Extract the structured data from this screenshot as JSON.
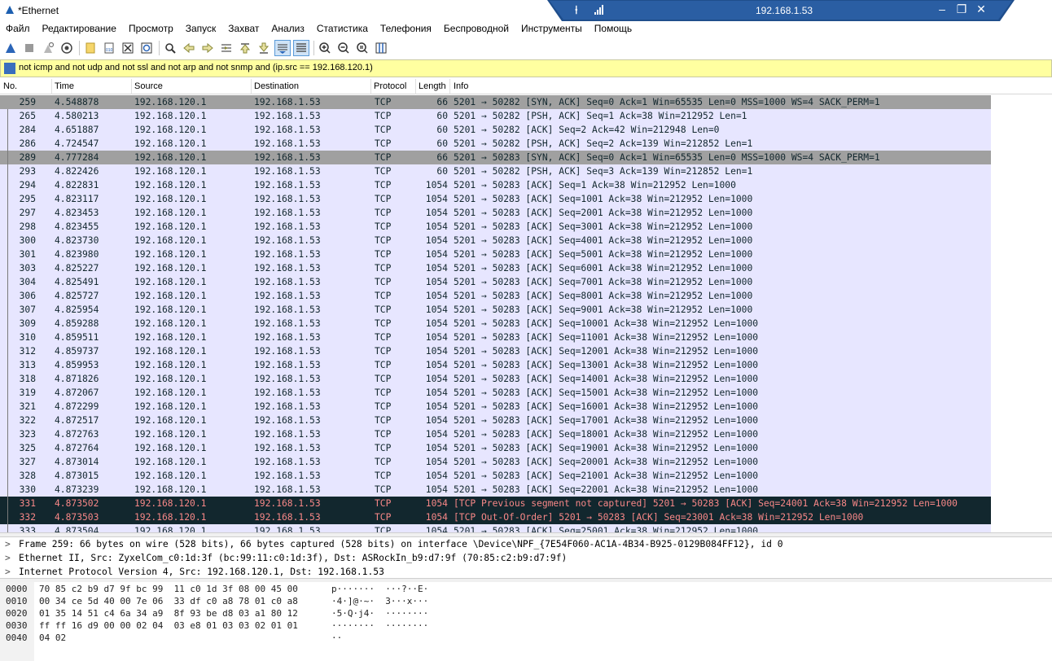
{
  "window": {
    "title": "*Ethernet"
  },
  "remote": {
    "ip": "192.168.1.53",
    "minimize": "‒",
    "restore": "❐",
    "close": "✕",
    "pin": "⍿"
  },
  "menu": [
    "Файл",
    "Редактирование",
    "Просмотр",
    "Запуск",
    "Захват",
    "Анализ",
    "Статистика",
    "Телефония",
    "Беспроводной",
    "Инструменты",
    "Помощь"
  ],
  "filter": {
    "value": "not icmp and not udp and not ssl and not arp and not snmp and (ip.src == 192.168.120.1)"
  },
  "columns": {
    "no": "No.",
    "time": "Time",
    "source": "Source",
    "destination": "Destination",
    "protocol": "Protocol",
    "length": "Length",
    "info": "Info"
  },
  "packets": [
    {
      "no": "259",
      "time": "4.548878",
      "src": "192.168.120.1",
      "dst": "192.168.1.53",
      "proto": "TCP",
      "len": "66",
      "info": "5201 → 50282 [SYN, ACK] Seq=0 Ack=1 Win=65535 Len=0 MSS=1000 WS=4 SACK_PERM=1",
      "style": "sel"
    },
    {
      "no": "265",
      "time": "4.580213",
      "src": "192.168.120.1",
      "dst": "192.168.1.53",
      "proto": "TCP",
      "len": "60",
      "info": "5201 → 50282 [PSH, ACK] Seq=1 Ack=38 Win=212952 Len=1",
      "style": ""
    },
    {
      "no": "284",
      "time": "4.651887",
      "src": "192.168.120.1",
      "dst": "192.168.1.53",
      "proto": "TCP",
      "len": "60",
      "info": "5201 → 50282 [ACK] Seq=2 Ack=42 Win=212948 Len=0",
      "style": ""
    },
    {
      "no": "286",
      "time": "4.724547",
      "src": "192.168.120.1",
      "dst": "192.168.1.53",
      "proto": "TCP",
      "len": "60",
      "info": "5201 → 50282 [PSH, ACK] Seq=2 Ack=139 Win=212852 Len=1",
      "style": ""
    },
    {
      "no": "289",
      "time": "4.777284",
      "src": "192.168.120.1",
      "dst": "192.168.1.53",
      "proto": "TCP",
      "len": "66",
      "info": "5201 → 50283 [SYN, ACK] Seq=0 Ack=1 Win=65535 Len=0 MSS=1000 WS=4 SACK_PERM=1",
      "style": "sel"
    },
    {
      "no": "293",
      "time": "4.822426",
      "src": "192.168.120.1",
      "dst": "192.168.1.53",
      "proto": "TCP",
      "len": "60",
      "info": "5201 → 50282 [PSH, ACK] Seq=3 Ack=139 Win=212852 Len=1",
      "style": ""
    },
    {
      "no": "294",
      "time": "4.822831",
      "src": "192.168.120.1",
      "dst": "192.168.1.53",
      "proto": "TCP",
      "len": "1054",
      "info": "5201 → 50283 [ACK] Seq=1 Ack=38 Win=212952 Len=1000",
      "style": ""
    },
    {
      "no": "295",
      "time": "4.823117",
      "src": "192.168.120.1",
      "dst": "192.168.1.53",
      "proto": "TCP",
      "len": "1054",
      "info": "5201 → 50283 [ACK] Seq=1001 Ack=38 Win=212952 Len=1000",
      "style": ""
    },
    {
      "no": "297",
      "time": "4.823453",
      "src": "192.168.120.1",
      "dst": "192.168.1.53",
      "proto": "TCP",
      "len": "1054",
      "info": "5201 → 50283 [ACK] Seq=2001 Ack=38 Win=212952 Len=1000",
      "style": ""
    },
    {
      "no": "298",
      "time": "4.823455",
      "src": "192.168.120.1",
      "dst": "192.168.1.53",
      "proto": "TCP",
      "len": "1054",
      "info": "5201 → 50283 [ACK] Seq=3001 Ack=38 Win=212952 Len=1000",
      "style": ""
    },
    {
      "no": "300",
      "time": "4.823730",
      "src": "192.168.120.1",
      "dst": "192.168.1.53",
      "proto": "TCP",
      "len": "1054",
      "info": "5201 → 50283 [ACK] Seq=4001 Ack=38 Win=212952 Len=1000",
      "style": ""
    },
    {
      "no": "301",
      "time": "4.823980",
      "src": "192.168.120.1",
      "dst": "192.168.1.53",
      "proto": "TCP",
      "len": "1054",
      "info": "5201 → 50283 [ACK] Seq=5001 Ack=38 Win=212952 Len=1000",
      "style": ""
    },
    {
      "no": "303",
      "time": "4.825227",
      "src": "192.168.120.1",
      "dst": "192.168.1.53",
      "proto": "TCP",
      "len": "1054",
      "info": "5201 → 50283 [ACK] Seq=6001 Ack=38 Win=212952 Len=1000",
      "style": ""
    },
    {
      "no": "304",
      "time": "4.825491",
      "src": "192.168.120.1",
      "dst": "192.168.1.53",
      "proto": "TCP",
      "len": "1054",
      "info": "5201 → 50283 [ACK] Seq=7001 Ack=38 Win=212952 Len=1000",
      "style": ""
    },
    {
      "no": "306",
      "time": "4.825727",
      "src": "192.168.120.1",
      "dst": "192.168.1.53",
      "proto": "TCP",
      "len": "1054",
      "info": "5201 → 50283 [ACK] Seq=8001 Ack=38 Win=212952 Len=1000",
      "style": ""
    },
    {
      "no": "307",
      "time": "4.825954",
      "src": "192.168.120.1",
      "dst": "192.168.1.53",
      "proto": "TCP",
      "len": "1054",
      "info": "5201 → 50283 [ACK] Seq=9001 Ack=38 Win=212952 Len=1000",
      "style": ""
    },
    {
      "no": "309",
      "time": "4.859288",
      "src": "192.168.120.1",
      "dst": "192.168.1.53",
      "proto": "TCP",
      "len": "1054",
      "info": "5201 → 50283 [ACK] Seq=10001 Ack=38 Win=212952 Len=1000",
      "style": ""
    },
    {
      "no": "310",
      "time": "4.859511",
      "src": "192.168.120.1",
      "dst": "192.168.1.53",
      "proto": "TCP",
      "len": "1054",
      "info": "5201 → 50283 [ACK] Seq=11001 Ack=38 Win=212952 Len=1000",
      "style": ""
    },
    {
      "no": "312",
      "time": "4.859737",
      "src": "192.168.120.1",
      "dst": "192.168.1.53",
      "proto": "TCP",
      "len": "1054",
      "info": "5201 → 50283 [ACK] Seq=12001 Ack=38 Win=212952 Len=1000",
      "style": ""
    },
    {
      "no": "313",
      "time": "4.859953",
      "src": "192.168.120.1",
      "dst": "192.168.1.53",
      "proto": "TCP",
      "len": "1054",
      "info": "5201 → 50283 [ACK] Seq=13001 Ack=38 Win=212952 Len=1000",
      "style": ""
    },
    {
      "no": "318",
      "time": "4.871826",
      "src": "192.168.120.1",
      "dst": "192.168.1.53",
      "proto": "TCP",
      "len": "1054",
      "info": "5201 → 50283 [ACK] Seq=14001 Ack=38 Win=212952 Len=1000",
      "style": ""
    },
    {
      "no": "319",
      "time": "4.872067",
      "src": "192.168.120.1",
      "dst": "192.168.1.53",
      "proto": "TCP",
      "len": "1054",
      "info": "5201 → 50283 [ACK] Seq=15001 Ack=38 Win=212952 Len=1000",
      "style": ""
    },
    {
      "no": "321",
      "time": "4.872299",
      "src": "192.168.120.1",
      "dst": "192.168.1.53",
      "proto": "TCP",
      "len": "1054",
      "info": "5201 → 50283 [ACK] Seq=16001 Ack=38 Win=212952 Len=1000",
      "style": ""
    },
    {
      "no": "322",
      "time": "4.872517",
      "src": "192.168.120.1",
      "dst": "192.168.1.53",
      "proto": "TCP",
      "len": "1054",
      "info": "5201 → 50283 [ACK] Seq=17001 Ack=38 Win=212952 Len=1000",
      "style": ""
    },
    {
      "no": "323",
      "time": "4.872763",
      "src": "192.168.120.1",
      "dst": "192.168.1.53",
      "proto": "TCP",
      "len": "1054",
      "info": "5201 → 50283 [ACK] Seq=18001 Ack=38 Win=212952 Len=1000",
      "style": ""
    },
    {
      "no": "325",
      "time": "4.872764",
      "src": "192.168.120.1",
      "dst": "192.168.1.53",
      "proto": "TCP",
      "len": "1054",
      "info": "5201 → 50283 [ACK] Seq=19001 Ack=38 Win=212952 Len=1000",
      "style": ""
    },
    {
      "no": "327",
      "time": "4.873014",
      "src": "192.168.120.1",
      "dst": "192.168.1.53",
      "proto": "TCP",
      "len": "1054",
      "info": "5201 → 50283 [ACK] Seq=20001 Ack=38 Win=212952 Len=1000",
      "style": ""
    },
    {
      "no": "328",
      "time": "4.873015",
      "src": "192.168.120.1",
      "dst": "192.168.1.53",
      "proto": "TCP",
      "len": "1054",
      "info": "5201 → 50283 [ACK] Seq=21001 Ack=38 Win=212952 Len=1000",
      "style": ""
    },
    {
      "no": "330",
      "time": "4.873239",
      "src": "192.168.120.1",
      "dst": "192.168.1.53",
      "proto": "TCP",
      "len": "1054",
      "info": "5201 → 50283 [ACK] Seq=22001 Ack=38 Win=212952 Len=1000",
      "style": ""
    },
    {
      "no": "331",
      "time": "4.873502",
      "src": "192.168.120.1",
      "dst": "192.168.1.53",
      "proto": "TCP",
      "len": "1054",
      "info": "[TCP Previous segment not captured] 5201 → 50283 [ACK] Seq=24001 Ack=38 Win=212952 Len=1000",
      "style": "bad"
    },
    {
      "no": "332",
      "time": "4.873503",
      "src": "192.168.120.1",
      "dst": "192.168.1.53",
      "proto": "TCP",
      "len": "1054",
      "info": "[TCP Out-Of-Order] 5201 → 50283 [ACK] Seq=23001 Ack=38 Win=212952 Len=1000",
      "style": "bad"
    },
    {
      "no": "333",
      "time": "4.873504",
      "src": "192.168.120.1",
      "dst": "192.168.1.53",
      "proto": "TCP",
      "len": "1054",
      "info": "5201 → 50283 [ACK] Seq=25001 Ack=38 Win=212952 Len=1000",
      "style": ""
    }
  ],
  "details": [
    "Frame 259: 66 bytes on wire (528 bits), 66 bytes captured (528 bits) on interface \\Device\\NPF_{7E54F060-AC1A-4B34-B925-0129B084FF12}, id 0",
    "Ethernet II, Src: ZyxelCom_c0:1d:3f (bc:99:11:c0:1d:3f), Dst: ASRockIn_b9:d7:9f (70:85:c2:b9:d7:9f)",
    "Internet Protocol Version 4, Src: 192.168.120.1, Dst: 192.168.1.53"
  ],
  "details_arrow": ">",
  "bytes": [
    {
      "offset": "0000",
      "hex": "70 85 c2 b9 d7 9f bc 99  11 c0 1d 3f 08 00 45 00",
      "ascii": "p·······  ···?··E·"
    },
    {
      "offset": "0010",
      "hex": "00 34 ce 5d 40 00 7e 06  33 df c0 a8 78 01 c0 a8",
      "ascii": "·4·]@·~·  3···x···"
    },
    {
      "offset": "0020",
      "hex": "01 35 14 51 c4 6a 34 a9  8f 93 be d8 03 a1 80 12",
      "ascii": "·5·Q·j4·  ········"
    },
    {
      "offset": "0030",
      "hex": "ff ff 16 d9 00 00 02 04  03 e8 01 03 03 02 01 01",
      "ascii": "········  ········"
    },
    {
      "offset": "0040",
      "hex": "04 02",
      "ascii": "··"
    }
  ],
  "colors": {
    "rowNormal": "#e7e6ff",
    "rowSelected": "#a0a0a0",
    "rowBad": "#12272e",
    "rowBadText": "#f78787",
    "filterBg": "#ffffa0",
    "remoteBar": "#1f4e8c"
  }
}
